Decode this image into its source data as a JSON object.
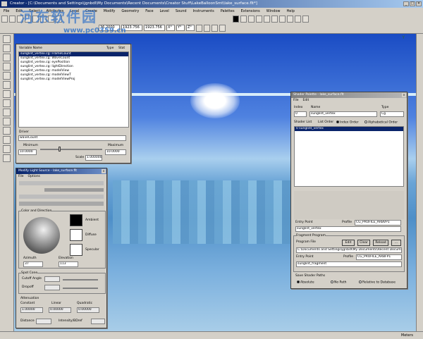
{
  "app": {
    "title": "Creator - [C:\\Documents and Settings\\jgnbdl\\My Documents\\Recent Documents\\Creator Stuff\\LakeBalloonSmt\\lake_surface.flt*]",
    "menus": [
      "File",
      "Edit",
      "Select",
      "Attributes",
      "Local",
      "Create",
      "Modify",
      "Geometry",
      "Face",
      "Level",
      "Sound",
      "Instruments",
      "Palettes",
      "Extensions",
      "Window",
      "Help"
    ],
    "toolbar_fields": [
      "36.2000",
      "1923.756",
      "1923.756"
    ],
    "toolbar_mode_buttons": [
      "X°",
      "Y°",
      "Z°"
    ],
    "status_left": "",
    "status_right": "Meters",
    "axis_label": "Y"
  },
  "watermark": {
    "text": "河东软件园",
    "url": "www.pc0359.cn"
  },
  "vertex_panel": {
    "headers": [
      "Variable Name",
      "Type",
      "Stat"
    ],
    "rows": [
      "sunglint_vertex.cg: FrameCount",
      "sunglint_vertex.cg: WaveCount",
      "sunglint_vertex.cg: eyePosition",
      "sunglint_vertex.cg: lightDirection",
      "sunglint_vertex.cg: modelView",
      "sunglint_vertex.cg: modelViewT",
      "sunglint_vertex.cg: modelViewProj"
    ],
    "driver_label": "Driver",
    "driver_value": "waveCount",
    "minimum_label": "Minimum",
    "maximum_label": "Maximum",
    "minimum_value": "10.0000",
    "maximum_value": "10.0000",
    "scale_label": "Scale",
    "scale_value": "1.000000"
  },
  "light_panel": {
    "title": "Modify Light Source - lake_surface.flt",
    "menus": [
      "File",
      "Options"
    ],
    "color_group": "Color and Direction",
    "swatches": [
      {
        "label": "Ambient",
        "color": "#000000"
      },
      {
        "label": "Diffuse",
        "color": "#ffffff"
      },
      {
        "label": "Specular",
        "color": "#ffffff"
      }
    ],
    "azimuth_label": "Azimuth",
    "azimuth_value": "37",
    "elevation_label": "Elevation",
    "elevation_value": "113",
    "spot_group": "Spot Cone",
    "cutoff_label": "Cutoff Angle",
    "dropoff_label": "Dropoff",
    "atten_group": "Attenuation",
    "constant_label": "Constant",
    "linear_label": "Linear",
    "quadratic_label": "Quadratic",
    "constant_value": "1.00000",
    "linear_value": "0.00000",
    "quadratic_value": "0.00000",
    "distance_label": "Distance",
    "intensity_label": "Intensity/BDref"
  },
  "shader_panel": {
    "title": "Shader Palette - lake_surface.flt",
    "menus": [
      "File",
      "Edit"
    ],
    "index_label": "Index",
    "index_value": "0",
    "name_label": "Name",
    "name_value": "sunglint_vertex",
    "type_label": "Type",
    "type_value": "Cg",
    "shader_list_label": "Shader List",
    "list_order_label": "List Order",
    "index_order_label": "Index Order",
    "alpha_order_label": "Alphabetical Order",
    "list_items": [
      "0   sunglint_vertex"
    ],
    "entry_label": "Entry Point",
    "profile_label": "Profile",
    "profile_value": "CG_PROFILE_ARBVP1",
    "entry_value": "sunglint_vertex",
    "fragment_group": "Fragment Program",
    "program_file_label": "Program File",
    "edit_label": "Edit",
    "clear_label": "Clear",
    "reload_label": "Reload",
    "more_label": "...",
    "program_file_value": "C:\\Documents and Settings\\jgnbdl\\My Documents\\Recent Documen",
    "frag_entry_label": "Entry Point",
    "frag_profile_label": "Profile",
    "frag_profile_value": "CG_PROFILE_ARBFP1",
    "frag_entry_value": "sunglint_fragment",
    "save_paths_label": "Save Shader Paths",
    "absolute_label": "Absolute",
    "no_path_label": "No Path",
    "relative_label": "Relative to Database"
  }
}
